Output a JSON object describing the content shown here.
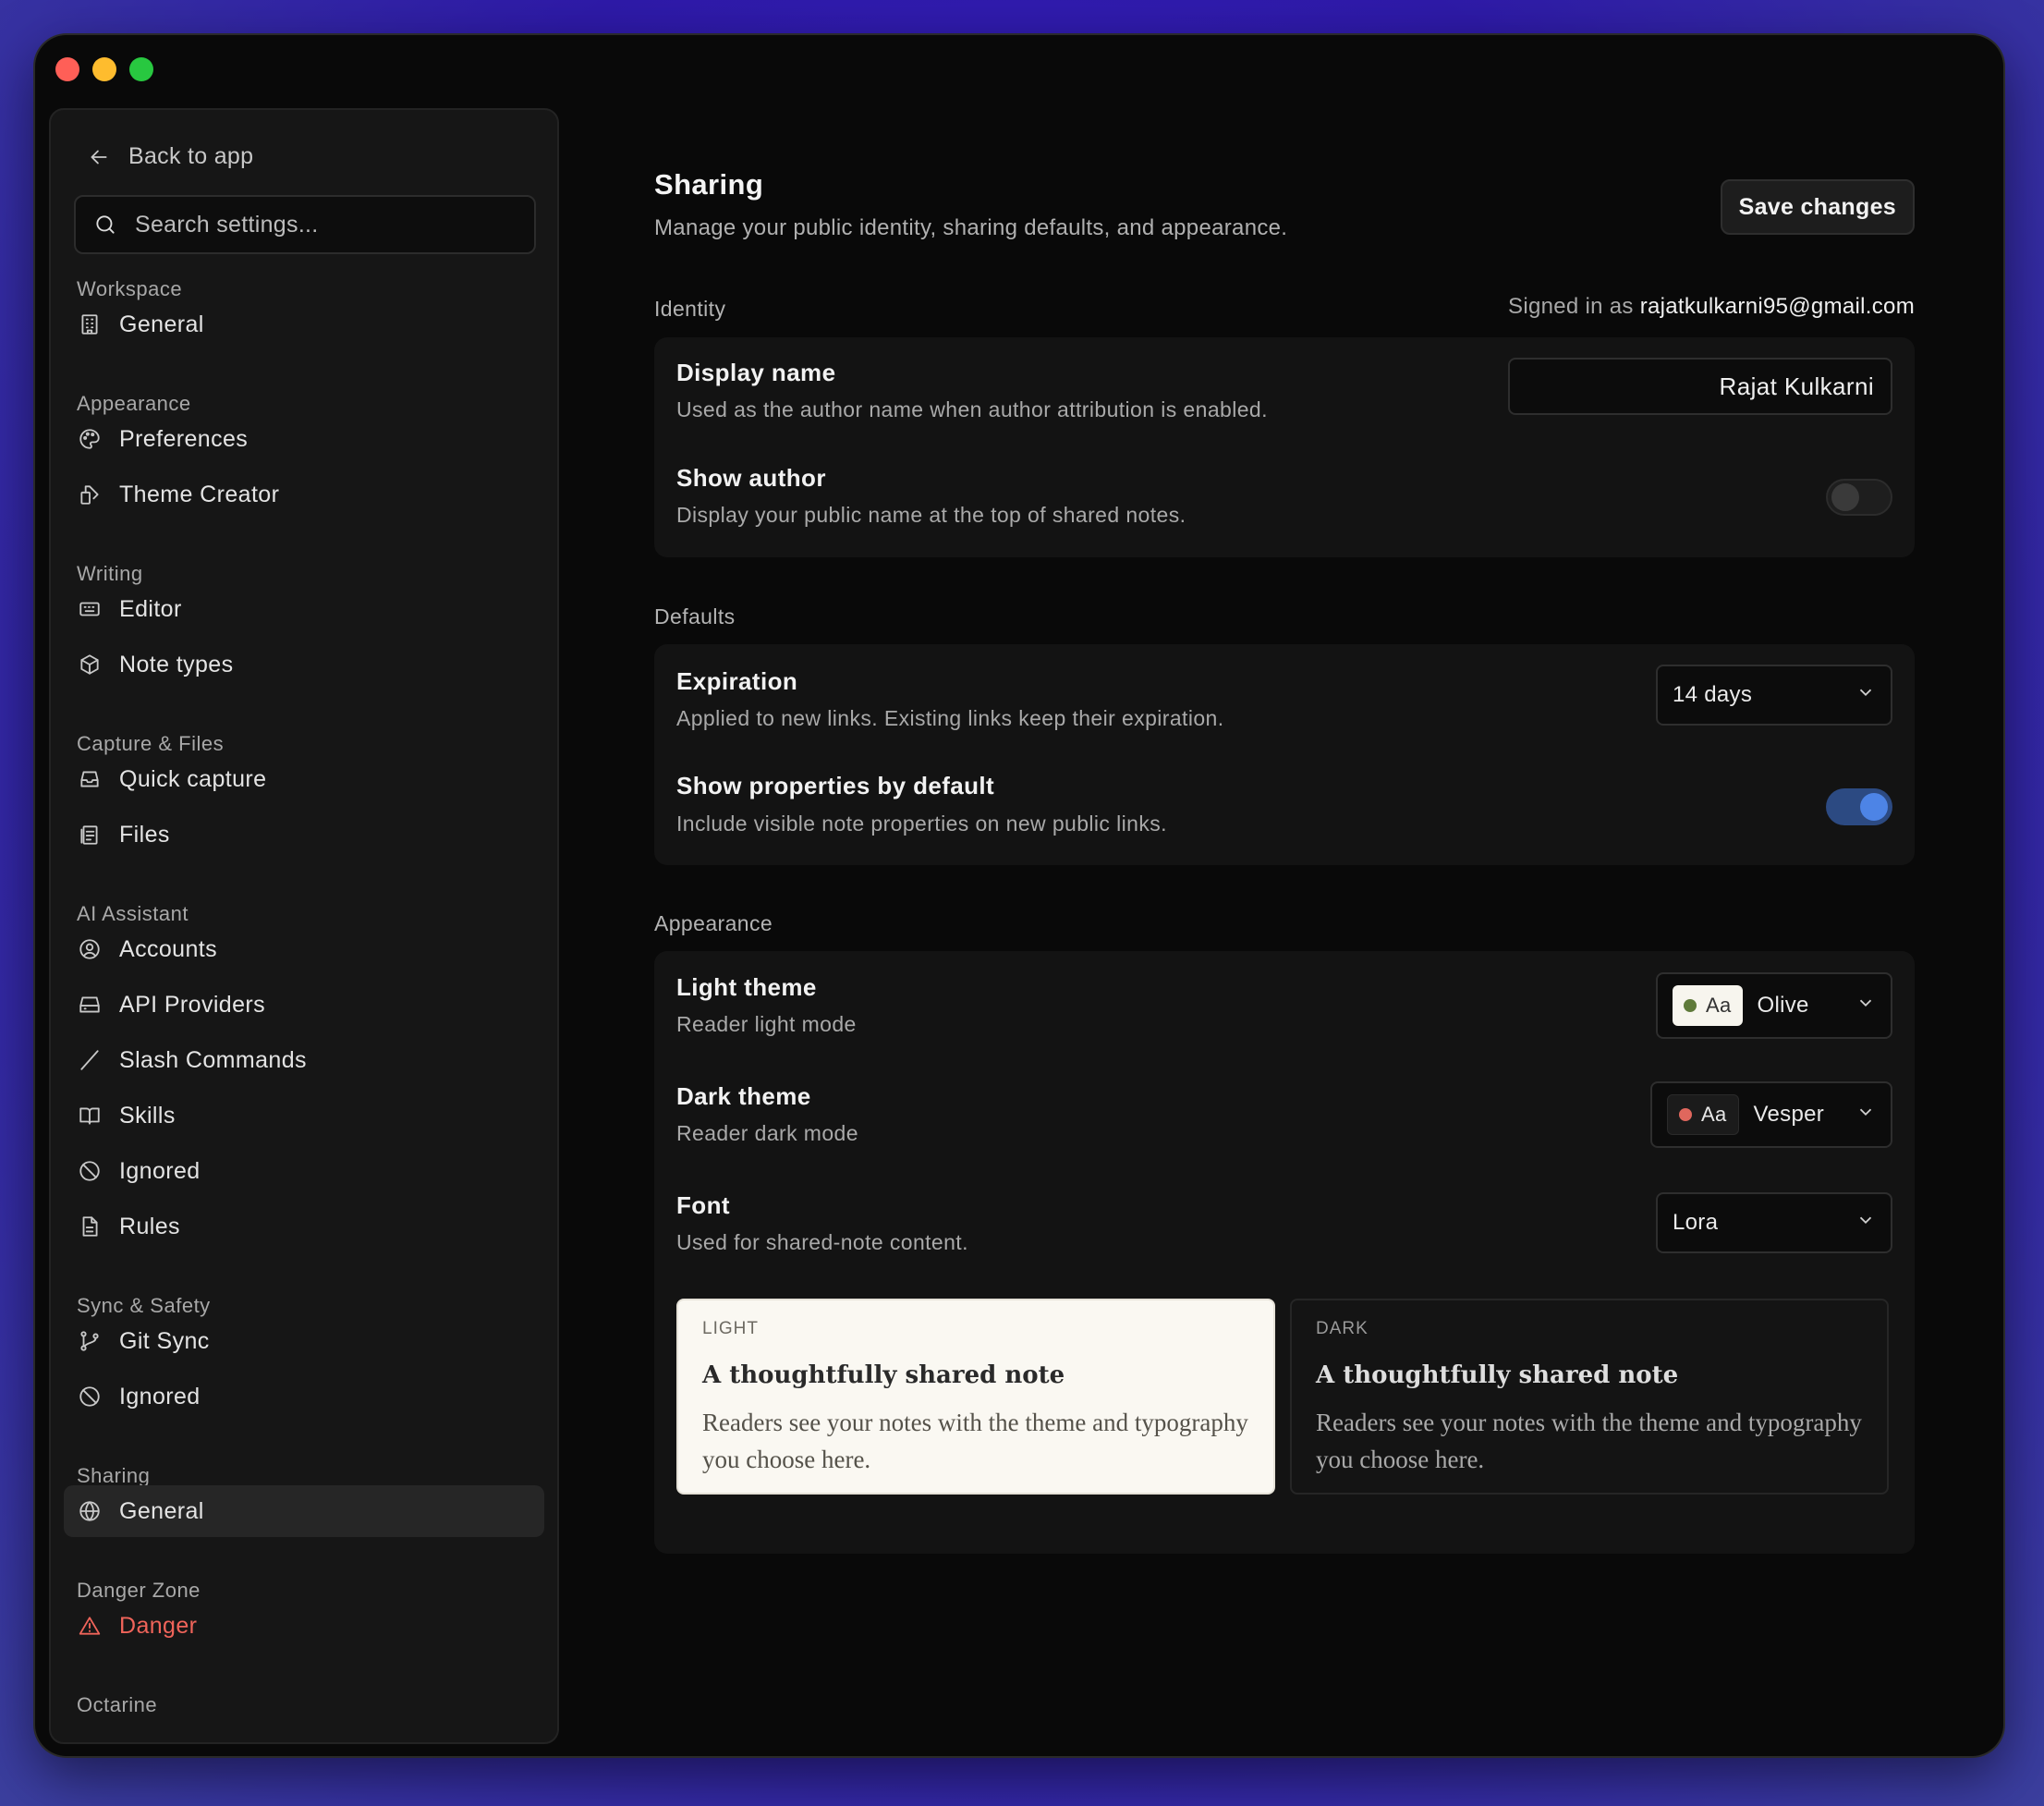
{
  "sidebar": {
    "back_label": "Back to app",
    "search_placeholder": "Search settings...",
    "sections": {
      "workspace": "Workspace",
      "appearance": "Appearance",
      "writing": "Writing",
      "capture": "Capture & Files",
      "ai": "AI Assistant",
      "sync": "Sync & Safety",
      "sharing": "Sharing",
      "danger": "Danger Zone",
      "octarine": "Octarine"
    },
    "items": {
      "general": "General",
      "preferences": "Preferences",
      "theme_creator": "Theme Creator",
      "editor": "Editor",
      "note_types": "Note types",
      "quick_capture": "Quick capture",
      "files": "Files",
      "accounts": "Accounts",
      "api_providers": "API Providers",
      "slash_commands": "Slash Commands",
      "skills": "Skills",
      "ignored_ai": "Ignored",
      "rules": "Rules",
      "git_sync": "Git Sync",
      "ignored_sync": "Ignored",
      "sharing_general": "General",
      "danger": "Danger"
    }
  },
  "header": {
    "title": "Sharing",
    "subtitle": "Manage your public identity, sharing defaults, and appearance.",
    "save_label": "Save changes"
  },
  "identity": {
    "label": "Identity",
    "signed_in_prefix": "Signed in as",
    "email": "rajatkulkarni95@gmail.com",
    "display_name_title": "Display name",
    "display_name_desc": "Used as the author name when author attribution is enabled.",
    "display_name_value": "Rajat Kulkarni",
    "show_author_title": "Show author",
    "show_author_desc": "Display your public name at the top of shared notes.",
    "show_author_on": false
  },
  "defaults": {
    "label": "Defaults",
    "expiration_title": "Expiration",
    "expiration_desc": "Applied to new links. Existing links keep their expiration.",
    "expiration_value": "14 days",
    "show_props_title": "Show properties by default",
    "show_props_desc": "Include visible note properties on new public links.",
    "show_props_on": true
  },
  "appearance": {
    "label": "Appearance",
    "light_theme_title": "Light theme",
    "light_theme_desc": "Reader light mode",
    "light_theme_value": "Olive",
    "light_chip": "Aa",
    "light_dot_color": "#5f7a3a",
    "dark_theme_title": "Dark theme",
    "dark_theme_desc": "Reader dark mode",
    "dark_theme_value": "Vesper",
    "dark_chip": "Aa",
    "dark_dot_color": "#e0675d",
    "font_title": "Font",
    "font_desc": "Used for shared-note content.",
    "font_value": "Lora",
    "preview_light_tag": "LIGHT",
    "preview_dark_tag": "DARK",
    "preview_title": "A thoughtfully shared note",
    "preview_body": "Readers see your notes with the theme and typography you choose here."
  },
  "colors": {
    "accent": "#4d84e6",
    "danger": "#f0645a",
    "background": "#090909"
  }
}
